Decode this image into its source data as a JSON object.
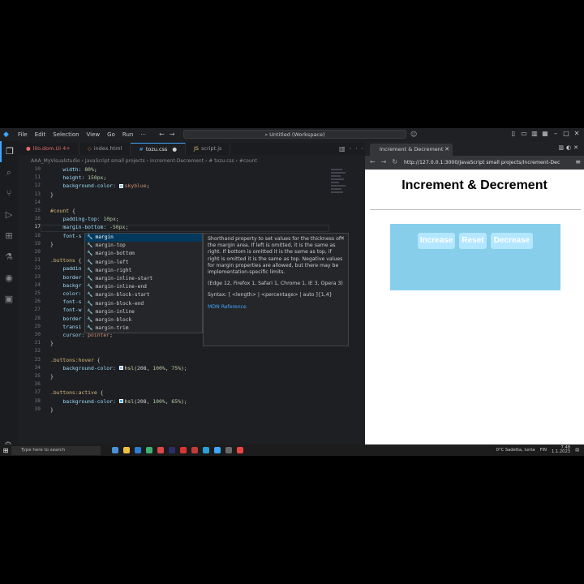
{
  "titlebar": {
    "menu": [
      "File",
      "Edit",
      "Selection",
      "View",
      "Go",
      "Run",
      "···"
    ],
    "command_center": "Untitled (Workspace)"
  },
  "tabs": [
    {
      "label": "lilo.dom.Ui 4+",
      "icon": "error-file",
      "state": "error"
    },
    {
      "label": "index.html",
      "icon": "html-file",
      "state": "normal"
    },
    {
      "label": "tozu.css",
      "icon": "css-file",
      "state": "active",
      "modified": true
    },
    {
      "label": "script.js",
      "icon": "js-file",
      "state": "normal"
    }
  ],
  "breadcrumb": "AAA_MyVisualstudio › JavaScript small projects › Increment-Decrement › # tozu.css › #count",
  "code_lines": [
    {
      "n": "10",
      "parts": [
        {
          "t": "    width: ",
          "c": "prop"
        },
        {
          "t": "80%",
          "c": "num"
        },
        {
          "t": ";",
          "c": "pun"
        }
      ]
    },
    {
      "n": "11",
      "parts": [
        {
          "t": "    height: ",
          "c": "prop"
        },
        {
          "t": "150px",
          "c": "num"
        },
        {
          "t": ";",
          "c": "pun"
        }
      ]
    },
    {
      "n": "12",
      "parts": [
        {
          "t": "    background-color: ",
          "c": "prop"
        },
        {
          "t": "skyblue",
          "c": "val",
          "swatch": "#87ceeb"
        },
        {
          "t": ";",
          "c": "pun"
        }
      ]
    },
    {
      "n": "13",
      "parts": [
        {
          "t": "}",
          "c": "pun"
        }
      ]
    },
    {
      "n": "14",
      "parts": []
    },
    {
      "n": "15",
      "parts": [
        {
          "t": "#count",
          "c": "sel"
        },
        {
          "t": " {",
          "c": "pun"
        }
      ]
    },
    {
      "n": "16",
      "parts": [
        {
          "t": "    padding-top: ",
          "c": "prop"
        },
        {
          "t": "10px",
          "c": "num"
        },
        {
          "t": ";",
          "c": "pun"
        }
      ]
    },
    {
      "n": "17",
      "parts": [
        {
          "t": "    margin-bottom: ",
          "c": "prop"
        },
        {
          "t": "-50px",
          "c": "num"
        },
        {
          "t": ";",
          "c": "pun"
        }
      ]
    },
    {
      "n": "18",
      "parts": [
        {
          "t": "    font-s",
          "c": "prop"
        }
      ]
    },
    {
      "n": "19",
      "parts": [
        {
          "t": "}",
          "c": "pun"
        }
      ]
    },
    {
      "n": "20",
      "parts": []
    },
    {
      "n": "21",
      "parts": [
        {
          "t": ".buttons",
          "c": "sel"
        },
        {
          "t": " {",
          "c": "pun"
        }
      ]
    },
    {
      "n": "22",
      "parts": [
        {
          "t": "    paddin",
          "c": "prop"
        }
      ]
    },
    {
      "n": "23",
      "parts": [
        {
          "t": "    border",
          "c": "prop"
        }
      ]
    },
    {
      "n": "24",
      "parts": [
        {
          "t": "    backgr",
          "c": "prop"
        }
      ]
    },
    {
      "n": "25",
      "parts": [
        {
          "t": "    color:",
          "c": "prop"
        }
      ]
    },
    {
      "n": "26",
      "parts": [
        {
          "t": "    font-s",
          "c": "prop"
        }
      ]
    },
    {
      "n": "27",
      "parts": [
        {
          "t": "    font-w",
          "c": "prop"
        }
      ]
    },
    {
      "n": "28",
      "parts": [
        {
          "t": "    border",
          "c": "prop"
        }
      ]
    },
    {
      "n": "29",
      "parts": [
        {
          "t": "    transi",
          "c": "prop"
        }
      ]
    },
    {
      "n": "30",
      "parts": [
        {
          "t": "    cursor: ",
          "c": "prop"
        },
        {
          "t": "pointer",
          "c": "val"
        },
        {
          "t": ";",
          "c": "pun"
        }
      ]
    },
    {
      "n": "31",
      "parts": [
        {
          "t": "}",
          "c": "pun"
        }
      ]
    },
    {
      "n": "32",
      "parts": []
    },
    {
      "n": "33",
      "parts": [
        {
          "t": ".buttons:hover",
          "c": "sel"
        },
        {
          "t": " {",
          "c": "pun"
        }
      ]
    },
    {
      "n": "34",
      "parts": [
        {
          "t": "    background-color: ",
          "c": "prop"
        },
        {
          "t": "hsl",
          "c": "fn",
          "swatch": "hsl(208,100%,75%)"
        },
        {
          "t": "(208, ",
          "c": "pun"
        },
        {
          "t": "100%",
          "c": "num"
        },
        {
          "t": ", ",
          "c": "pun"
        },
        {
          "t": "75%",
          "c": "num"
        },
        {
          "t": ");",
          "c": "pun"
        }
      ]
    },
    {
      "n": "35",
      "parts": [
        {
          "t": "}",
          "c": "pun"
        }
      ]
    },
    {
      "n": "36",
      "parts": []
    },
    {
      "n": "37",
      "parts": [
        {
          "t": ".buttons:active",
          "c": "sel"
        },
        {
          "t": " {",
          "c": "pun"
        }
      ]
    },
    {
      "n": "38",
      "parts": [
        {
          "t": "    background-color: ",
          "c": "prop"
        },
        {
          "t": "hsl",
          "c": "fn",
          "swatch": "hsl(208,100%,65%)"
        },
        {
          "t": "(208, ",
          "c": "pun"
        },
        {
          "t": "100%",
          "c": "num"
        },
        {
          "t": ", ",
          "c": "pun"
        },
        {
          "t": "65%",
          "c": "num"
        },
        {
          "t": ");",
          "c": "pun"
        }
      ]
    },
    {
      "n": "39",
      "parts": [
        {
          "t": "}",
          "c": "pun"
        }
      ]
    }
  ],
  "current_line": "17",
  "suggestions": [
    "margin",
    "margin-top",
    "margin-bottom",
    "margin-left",
    "margin-right",
    "margin-inline-start",
    "margin-inline-end",
    "margin-block-start",
    "margin-block-end",
    "margin-inline",
    "margin-block",
    "margin-trim"
  ],
  "selected_suggestion": 0,
  "docs": {
    "description": "Shorthand property to set values for the thickness of the margin area. If left is omitted, it is the same as right. If bottom is omitted it is the same as top, if right is omitted it is the same as top. Negative values for margin properties are allowed, but there may be implementation-specific limits.",
    "compat": "(Edge 12, Firefox 1, Safari 1, Chrome 1, IE 3, Opera 3)",
    "syntax": "Syntax: [ <length> | <percentage> | auto ]{1,4}",
    "link": "MDN Reference"
  },
  "browser": {
    "tab_title": "Increment & Decrement",
    "url": "http://127.0.0.1:3000/JavaScript small projects/Increment-Dec",
    "page_title": "Increment & Decrement",
    "buttons": [
      "Increase",
      "Reset",
      "Decrease"
    ],
    "count_box_color": "#87ceeb"
  },
  "taskbar": {
    "search_placeholder": "Type here to search",
    "weather": "0°C Sadetta, lunta",
    "lang": "FIN",
    "time": "7.48",
    "date": "1.1.2023"
  }
}
